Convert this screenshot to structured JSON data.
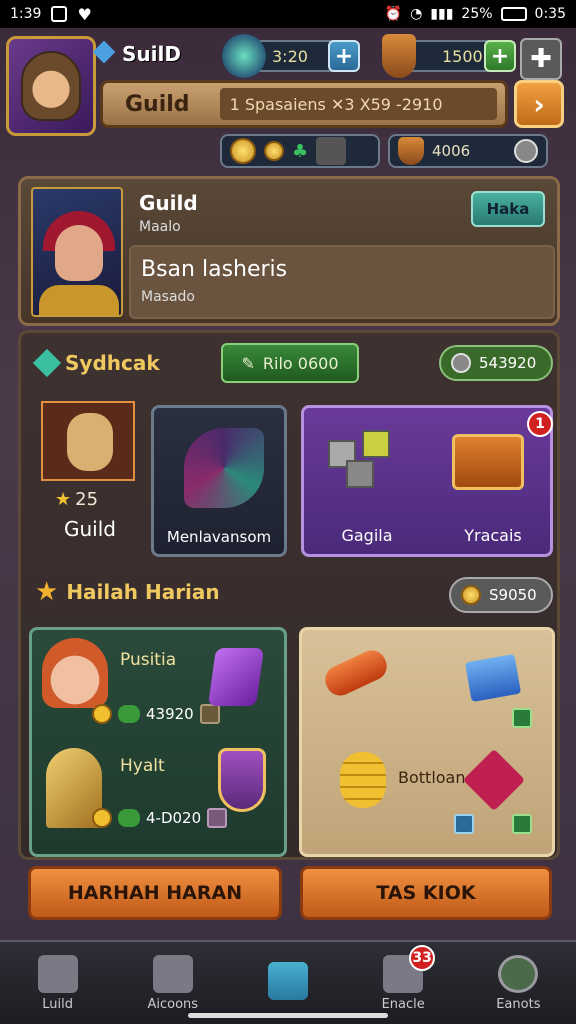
{
  "status_bar": {
    "time_left": "1:39",
    "battery": "25%",
    "time_right": "0:35"
  },
  "top": {
    "guild_label": "SuilD",
    "crystal_value": "3:20",
    "shield_value": "1500",
    "guild_title": "Guild",
    "guild_sub": "1 Spasaiens  ✕3  X59 -2910",
    "crystal_mini_value": "",
    "shield_mini_value": "4006"
  },
  "profile": {
    "name": "Guild",
    "role": "Maalo",
    "line3": "Bsan lasheris",
    "line4": "Masado",
    "take_label": "Haka"
  },
  "section1": {
    "title": "Sydhcak",
    "button_label": "Rilo 0600",
    "counter_value": "543920",
    "card1_stars": "25",
    "card1_label": "Guild",
    "card2_label": "Menlavansom",
    "card3_left_label": "Gagila",
    "card3_right_label": "Yracais",
    "card3_badge": "1"
  },
  "section2": {
    "title": "Hailah Harian",
    "counter_value": "S9050",
    "item1_name": "Pusitia",
    "item1_value": "43920",
    "item2_name": "Hyalt",
    "item2_value": "4-D020",
    "reward_label": "Bottloan"
  },
  "buttons": {
    "left": "HARHAH HARAN",
    "right": "TAS KIOK"
  },
  "nav": {
    "items": [
      {
        "label": "Luild"
      },
      {
        "label": "Aicoons"
      },
      {
        "label": ""
      },
      {
        "label": "Enacle",
        "badge": "33"
      },
      {
        "label": "Eanots"
      }
    ]
  }
}
